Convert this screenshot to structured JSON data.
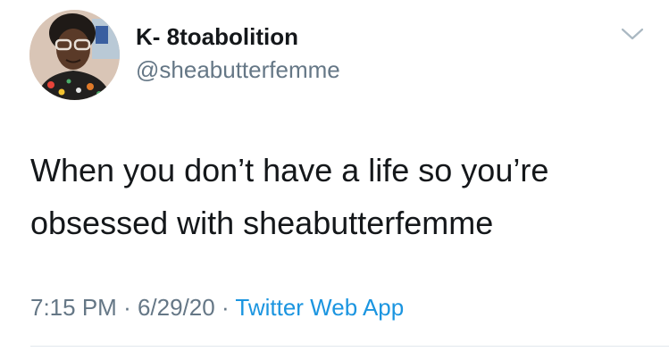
{
  "user": {
    "display_name": "K- 8toabolition",
    "handle": "@sheabutterfemme",
    "avatar_icon": "profile-photo"
  },
  "menu": {
    "icon": "chevron-down-icon"
  },
  "tweet": {
    "text": "When you don’t have a life so you’re obsessed with sheabutterfemme",
    "time": "7:15 PM",
    "separator": "·",
    "date": "6/29/20",
    "source": "Twitter Web App"
  },
  "colors": {
    "text": "#14171a",
    "secondary": "#657786",
    "link": "#1b95e0",
    "divider": "#e1e8ed"
  }
}
